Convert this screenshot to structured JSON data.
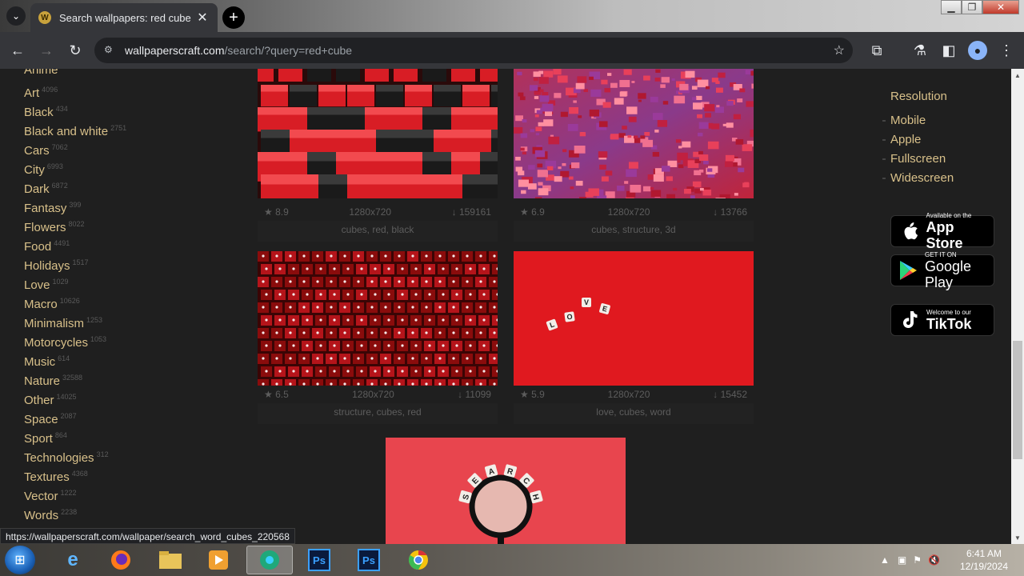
{
  "browser": {
    "tab_title": "Search wallpapers: red cube",
    "url_domain": "wallpaperscraft.com",
    "url_path": "/search/?query=red+cube"
  },
  "categories": [
    {
      "name": "Anime",
      "count": ""
    },
    {
      "name": "Art",
      "count": "4096"
    },
    {
      "name": "Black",
      "count": "434"
    },
    {
      "name": "Black and white",
      "count": "2751"
    },
    {
      "name": "Cars",
      "count": "7062"
    },
    {
      "name": "City",
      "count": "6993"
    },
    {
      "name": "Dark",
      "count": "6872"
    },
    {
      "name": "Fantasy",
      "count": "399"
    },
    {
      "name": "Flowers",
      "count": "8022"
    },
    {
      "name": "Food",
      "count": "4491"
    },
    {
      "name": "Holidays",
      "count": "1517"
    },
    {
      "name": "Love",
      "count": "1029"
    },
    {
      "name": "Macro",
      "count": "10626"
    },
    {
      "name": "Minimalism",
      "count": "1253"
    },
    {
      "name": "Motorcycles",
      "count": "1053"
    },
    {
      "name": "Music",
      "count": "614"
    },
    {
      "name": "Nature",
      "count": "32588"
    },
    {
      "name": "Other",
      "count": "14025"
    },
    {
      "name": "Space",
      "count": "2087"
    },
    {
      "name": "Sport",
      "count": "864"
    },
    {
      "name": "Technologies",
      "count": "312"
    },
    {
      "name": "Textures",
      "count": "4368"
    },
    {
      "name": "Vector",
      "count": "1222"
    },
    {
      "name": "Words",
      "count": "2238"
    }
  ],
  "wallpapers": [
    {
      "rating": "8.9",
      "resolution": "1280x720",
      "downloads": "159161",
      "tags": "cubes, red, black"
    },
    {
      "rating": "6.9",
      "resolution": "1280x720",
      "downloads": "13766",
      "tags": "cubes, structure, 3d"
    },
    {
      "rating": "6.5",
      "resolution": "1280x720",
      "downloads": "11099",
      "tags": "structure, cubes, red"
    },
    {
      "rating": "5.9",
      "resolution": "1280x720",
      "downloads": "15452",
      "tags": "love, cubes, word"
    }
  ],
  "love_letters": [
    "L",
    "O",
    "V",
    "E"
  ],
  "search_letters": [
    "S",
    "E",
    "A",
    "R",
    "C",
    "H"
  ],
  "sidebar": {
    "heading": "Resolution",
    "items": [
      "Mobile",
      "Apple",
      "Fullscreen",
      "Widescreen"
    ]
  },
  "badges": {
    "appstore_small": "Available on the",
    "appstore_big": "App Store",
    "googleplay_small": "GET IT ON",
    "googleplay_big": "Google Play",
    "tiktok_small": "Welcome to our",
    "tiktok_big": "TikTok"
  },
  "status_url": "https://wallpaperscraft.com/wallpaper/search_word_cubes_220568",
  "clock": {
    "time": "6:41 AM",
    "date": "12/19/2024"
  },
  "colors": {
    "accent": "#d8c08a",
    "red": "#e0191f"
  }
}
